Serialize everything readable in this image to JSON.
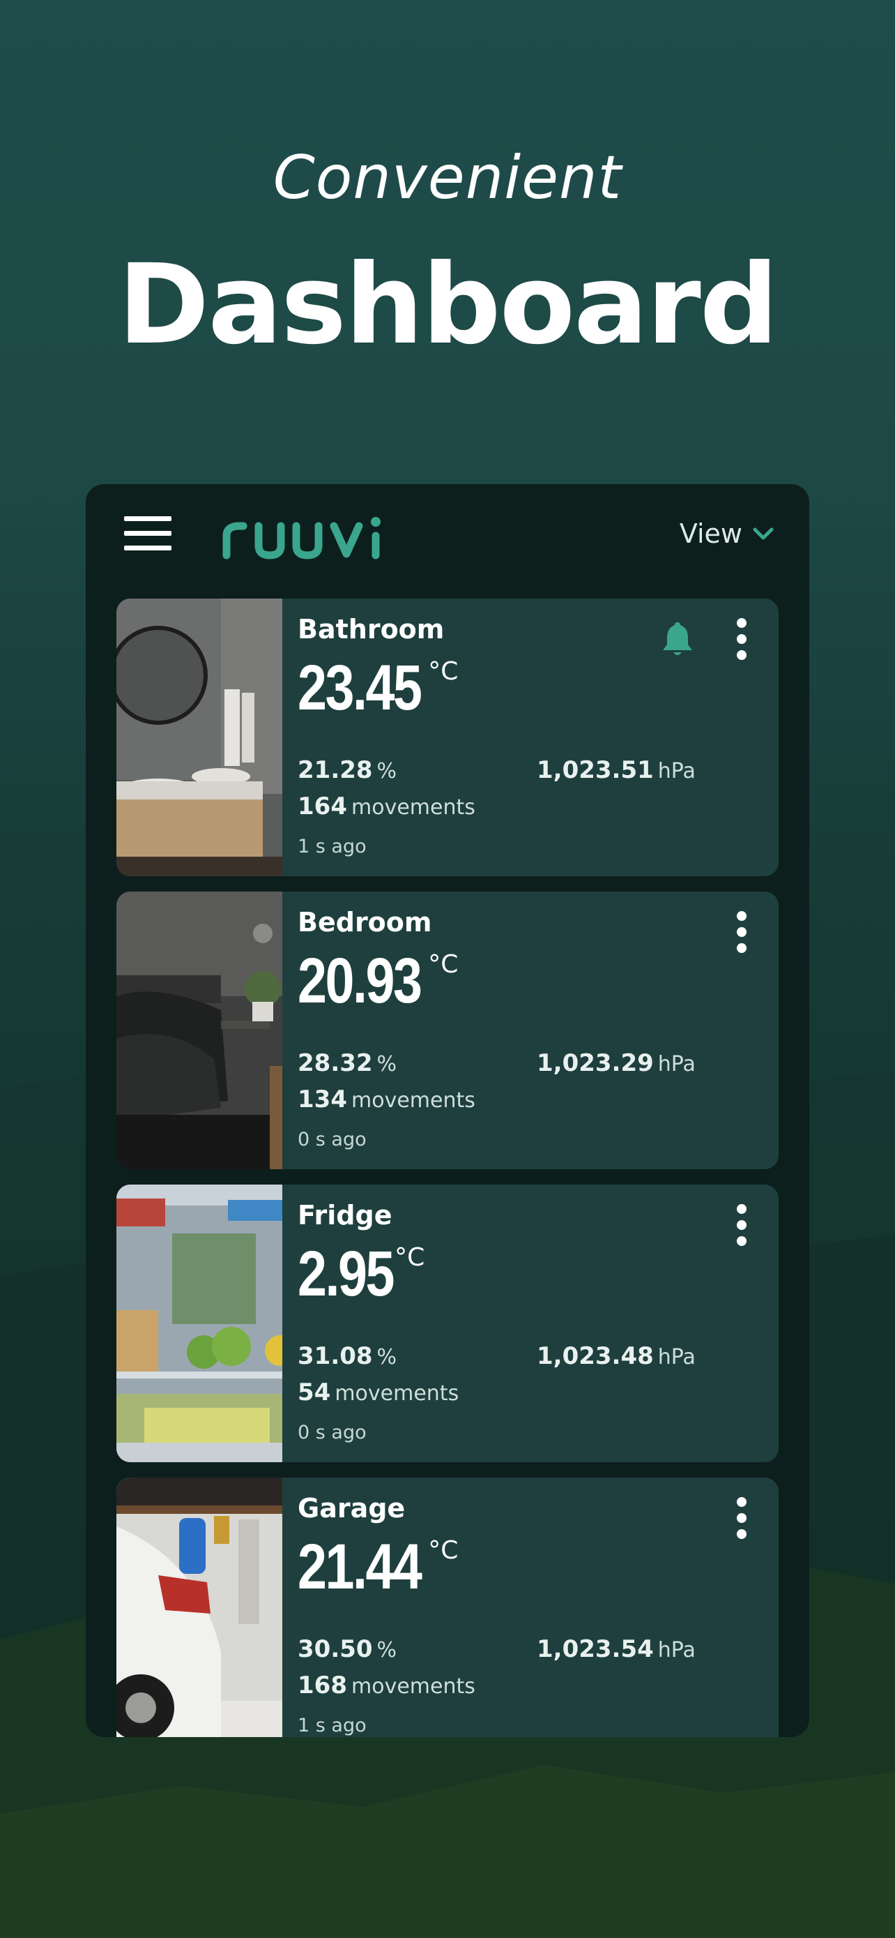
{
  "headline": {
    "line1": "Convenient",
    "line2": "Dashboard"
  },
  "app": {
    "logo_text": "ruuvi",
    "view_label": "View",
    "colors": {
      "accent": "#3aa68d",
      "card_bg": "#1e3f3d",
      "panel_bg": "#0c1f1d"
    }
  },
  "sensors": [
    {
      "name": "Bathroom",
      "temperature": "23.45",
      "temp_unit": "°C",
      "humidity": "21.28",
      "humidity_unit": "%",
      "pressure": "1,023.51",
      "pressure_unit": "hPa",
      "movements": "164",
      "movements_label": "movements",
      "updated": "1 s ago",
      "alert": "bell-icon"
    },
    {
      "name": "Bedroom",
      "temperature": "20.93",
      "temp_unit": "°C",
      "humidity": "28.32",
      "humidity_unit": "%",
      "pressure": "1,023.29",
      "pressure_unit": "hPa",
      "movements": "134",
      "movements_label": "movements",
      "updated": "0 s ago"
    },
    {
      "name": "Fridge",
      "temperature": "2.95",
      "temp_unit": "°C",
      "humidity": "31.08",
      "humidity_unit": "%",
      "pressure": "1,023.48",
      "pressure_unit": "hPa",
      "movements": "54",
      "movements_label": "movements",
      "updated": "0 s ago"
    },
    {
      "name": "Garage",
      "temperature": "21.44",
      "temp_unit": "°C",
      "humidity": "30.50",
      "humidity_unit": "%",
      "pressure": "1,023.54",
      "pressure_unit": "hPa",
      "movements": "168",
      "movements_label": "movements",
      "updated": "1 s ago"
    }
  ]
}
